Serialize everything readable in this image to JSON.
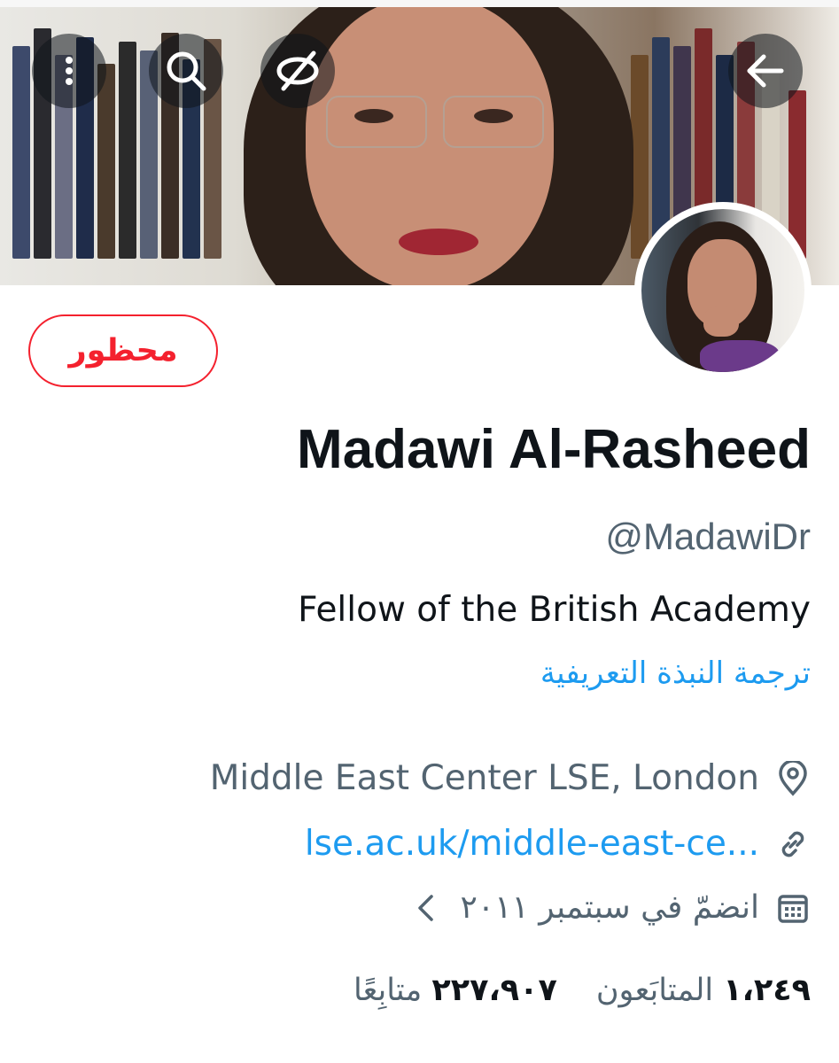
{
  "header": {
    "back_icon": "arrow-left-icon",
    "hide_icon": "eye-off-icon",
    "search_icon": "search-icon",
    "more_icon": "more-vertical-icon"
  },
  "profile": {
    "blocked_label": "محظور",
    "name": "Madawi Al-Rasheed",
    "handle": "@MadawiDr",
    "bio": "Fellow of the British Academy",
    "translate_bio": "ترجمة النبذة التعريفية",
    "location": "Middle East Center LSE, London",
    "website": "lse.ac.uk/middle-east-ce...",
    "joined": "انضمّ في سبتمبر ٢٠١١",
    "following_count": "١،٢٤٩",
    "following_label": "المتابَعون",
    "followers_count": "٢٢٧،٩٠٧",
    "followers_label": "متابِعًا"
  },
  "colors": {
    "accent": "#1d9bf0",
    "blocked": "#f4212e",
    "secondary_text": "#536471",
    "primary_text": "#0f1419"
  }
}
